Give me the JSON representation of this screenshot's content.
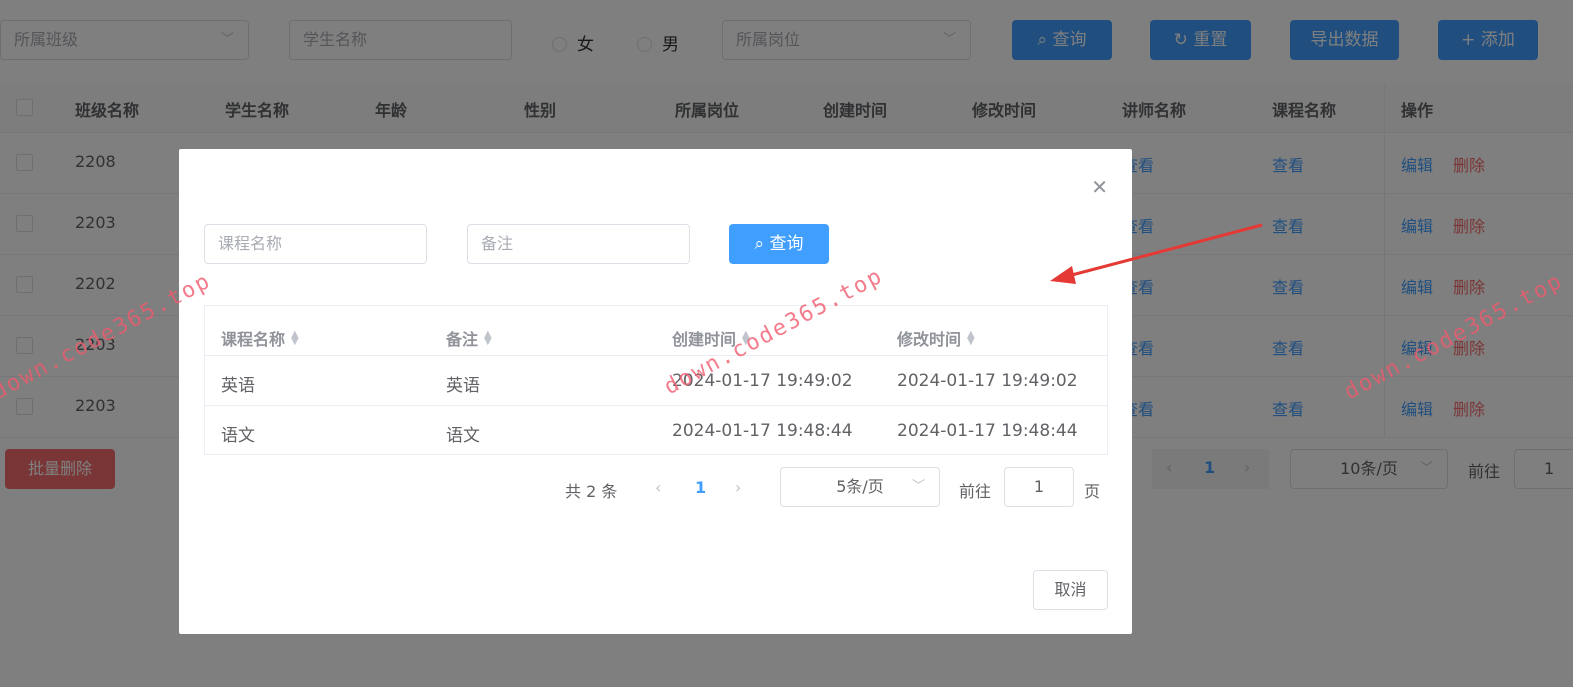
{
  "filters": {
    "class_placeholder": "所属班级",
    "student_placeholder": "学生名称",
    "gender_options": [
      "女",
      "男"
    ],
    "post_placeholder": "所属岗位"
  },
  "toolbar": {
    "search": "查询",
    "reset": "重置",
    "export": "导出数据",
    "add": "添加"
  },
  "table": {
    "headers": [
      "班级名称",
      "学生名称",
      "年龄",
      "性别",
      "所属岗位",
      "创建时间",
      "修改时间",
      "讲师名称",
      "课程名称",
      "操作"
    ],
    "rows": [
      {
        "class": "2208"
      },
      {
        "class": "2203"
      },
      {
        "class": "2202"
      },
      {
        "class": "2203"
      },
      {
        "class": "2203"
      }
    ],
    "view_label": "查看",
    "view_label_partial": "看",
    "edit_label": "编辑",
    "delete_label": "删除"
  },
  "batch_delete": "批量删除",
  "pagination": {
    "current": "1",
    "page_size": "10条/页",
    "goto_label": "前往",
    "goto_value": "1"
  },
  "modal": {
    "course_placeholder": "课程名称",
    "remark_placeholder": "备注",
    "search": "查询",
    "headers": [
      "课程名称",
      "备注",
      "创建时间",
      "修改时间"
    ],
    "rows": [
      {
        "name": "英语",
        "remark": "英语",
        "created": "2024-01-17 19:49:02",
        "modified": "2024-01-17 19:49:02"
      },
      {
        "name": "语文",
        "remark": "语文",
        "created": "2024-01-17 19:48:44",
        "modified": "2024-01-17 19:48:44"
      }
    ],
    "pagination": {
      "total": "共 2 条",
      "current": "1",
      "page_size": "5条/页",
      "goto_label": "前往",
      "goto_value": "1",
      "page_suffix": "页"
    },
    "cancel": "取消"
  },
  "watermark": "down.code365.top",
  "colors": {
    "primary": "#409eff",
    "danger": "#f56c6c",
    "arrow": "#e53935"
  }
}
